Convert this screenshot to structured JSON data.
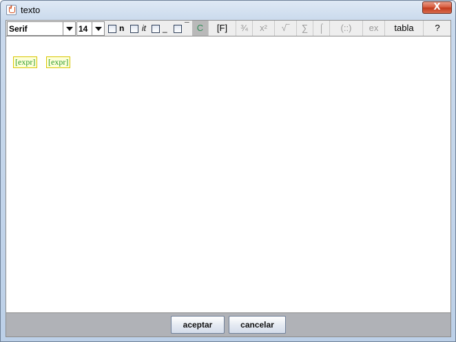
{
  "window": {
    "title": "texto",
    "close_glyph": "X"
  },
  "toolbar": {
    "font_family": "Serif",
    "font_size": "14",
    "checks": {
      "bold_label": "n",
      "italic_label": "it",
      "underline_label": "_",
      "overline_label": "¯"
    },
    "buttons": {
      "color": "C",
      "formula": "[F]",
      "fraction": "¾",
      "power": "x²",
      "sqrt": "√‾",
      "sum": "∑",
      "integral": "⌠",
      "matrix": "(::)",
      "ex": "ex",
      "table": "tabla",
      "help": "?"
    }
  },
  "editor": {
    "items": [
      "[expr]",
      "[expr]"
    ]
  },
  "footer": {
    "accept_label": "aceptar",
    "cancel_label": "cancelar"
  }
}
